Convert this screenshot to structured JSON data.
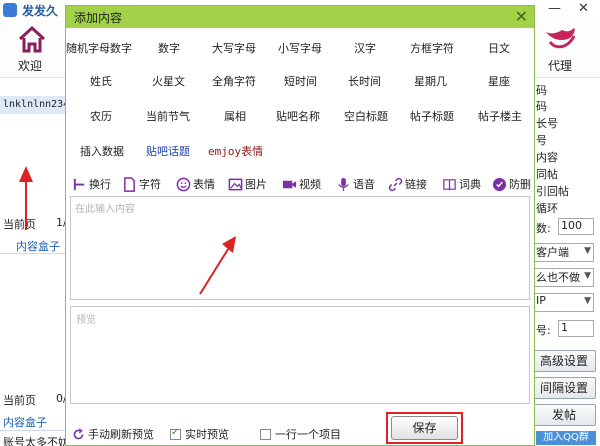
{
  "window": {
    "title": "发发久",
    "title_suffix": "",
    "close_glyph": "✕",
    "min_glyph": "—"
  },
  "toolbar": {
    "welcome_label": "欢迎",
    "proxy_label": "代理"
  },
  "left_panel": {
    "field_text": "lnklnlnn234",
    "current_page_1": "当前页",
    "page_1": "1/",
    "content_box_1": "内容盒子",
    "current_page_2": "当前页",
    "page_2": "0/",
    "content_box_2": "内容盒子",
    "account_text": "账号太多不妨"
  },
  "right_panel": {
    "items": [
      "码",
      "码",
      "长号",
      "号",
      "内容",
      "同帖",
      "引回帖",
      "循环"
    ],
    "count_label": "数:",
    "count_value": "100",
    "client_select": "客户端",
    "mode_select": "么也不做",
    "ip_select": "IP",
    "num_label": "号:",
    "num_value": "1",
    "btn_advanced": "高级设置",
    "btn_interval": "间隔设置",
    "btn_post": "发帖",
    "btn_join_qq": "加入QQ群"
  },
  "dialog": {
    "title": "添加内容",
    "close_glyph": "✕",
    "tags": [
      "随机字母数字",
      "数字",
      "大写字母",
      "小写字母",
      "汉字",
      "方框字符",
      "日文",
      "姓氏",
      "火星文",
      "全角字符",
      "短时间",
      "长时间",
      "星期几",
      "星座",
      "农历",
      "当前节气",
      "属相",
      "贴吧名称",
      "空白标题",
      "帖子标题",
      "帖子楼主"
    ],
    "insert_data": "插入数据",
    "tieba_topic": "贴吧话题",
    "emjoy": "emjoy表情",
    "toolbar": {
      "newline": "换行",
      "font": "字符",
      "emoji": "表情",
      "image": "图片",
      "video": "视频",
      "voice": "语音",
      "link": "链接",
      "dictionary": "词典",
      "anti_delete": "防删"
    },
    "content_placeholder": "在此输入内容",
    "preview_placeholder": "预览",
    "manual_refresh": "手动刷新预览",
    "realtime_preview": "实时预览",
    "realtime_checked": true,
    "one_per_line": "一行一个项目",
    "one_per_line_checked": false,
    "save_label": "保存"
  },
  "colors": {
    "dialog_title_bg": "#a3d148",
    "highlight": "#dd2222",
    "arrow": "#dd2222"
  }
}
